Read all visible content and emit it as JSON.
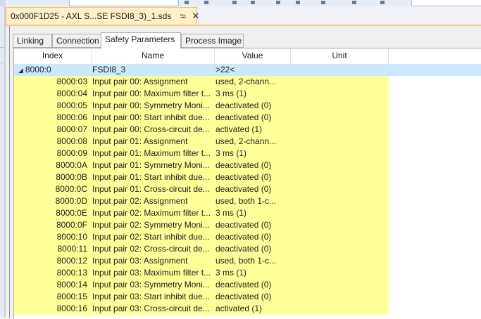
{
  "document_tab": {
    "title": "0x000F1D25 - AXL S...SE FSDI8_3)_1.sds",
    "pin_glyph": "⭾",
    "close_glyph": "✕"
  },
  "tabs": [
    {
      "label": "Linking"
    },
    {
      "label": "Connection"
    },
    {
      "label": "Safety Parameters"
    },
    {
      "label": "Process Image"
    }
  ],
  "table": {
    "columns": [
      "Index",
      "Name",
      "Value",
      "Unit"
    ],
    "group": {
      "index": "8000:0",
      "name": "FSDI8_3",
      "value": ">22<"
    },
    "rows": [
      {
        "index": "8000:03",
        "name": "Input pair 00: Assignment",
        "value": "used, 2-chann..."
      },
      {
        "index": "8000:04",
        "name": "Input pair 00: Maximum filter t...",
        "value": "3 ms (1)"
      },
      {
        "index": "8000:05",
        "name": "Input pair 00: Symmetry Moni...",
        "value": "deactivated (0)"
      },
      {
        "index": "8000:06",
        "name": "Input pair 00: Start inhibit due...",
        "value": "deactivated (0)"
      },
      {
        "index": "8000:07",
        "name": "Input pair 00: Cross-circuit de...",
        "value": "activated (1)"
      },
      {
        "index": "8000:08",
        "name": "Input pair 01: Assignment",
        "value": "used, 2-chann..."
      },
      {
        "index": "8000:09",
        "name": "Input pair 01: Maximum filter t...",
        "value": "3 ms (1)"
      },
      {
        "index": "8000:0A",
        "name": "Input pair 01: Symmetry Moni...",
        "value": "deactivated (0)"
      },
      {
        "index": "8000:0B",
        "name": "Input pair 01: Start inhibit due...",
        "value": "deactivated (0)"
      },
      {
        "index": "8000:0C",
        "name": "Input pair 01: Cross-circuit de...",
        "value": "deactivated (0)"
      },
      {
        "index": "8000:0D",
        "name": "Input pair 02: Assignment",
        "value": "used, both 1-c..."
      },
      {
        "index": "8000:0E",
        "name": "Input pair 02: Maximum filter t...",
        "value": "3 ms (1)"
      },
      {
        "index": "8000:0F",
        "name": "Input pair 02: Symmetry Moni...",
        "value": "deactivated (0)"
      },
      {
        "index": "8000:10",
        "name": "Input pair 02: Start inhibit due...",
        "value": "deactivated (0)"
      },
      {
        "index": "8000:11",
        "name": "Input pair 02: Cross-circuit de...",
        "value": "deactivated (0)"
      },
      {
        "index": "8000:12",
        "name": "Input pair 03: Assignment",
        "value": "used, both 1-c..."
      },
      {
        "index": "8000:13",
        "name": "Input pair 03: Maximum filter t...",
        "value": "3 ms (1)"
      },
      {
        "index": "8000:14",
        "name": "Input pair 03: Symmetry Moni...",
        "value": "deactivated (0)"
      },
      {
        "index": "8000:15",
        "name": "Input pair 03: Start inhibit due...",
        "value": "deactivated (0)"
      },
      {
        "index": "8000:16",
        "name": "Input pair 03: Cross-circuit de...",
        "value": "activated (1)"
      }
    ]
  },
  "colors": {
    "row_highlight": "#ffff99",
    "group_row": "#cce8ff",
    "document_tab": "#fff0c8"
  }
}
